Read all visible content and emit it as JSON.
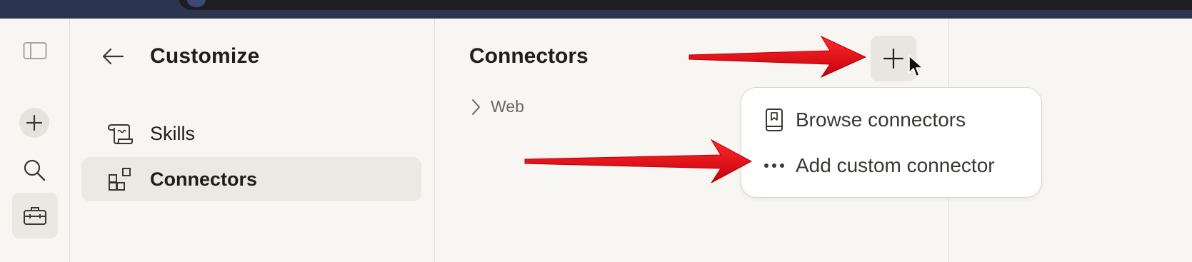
{
  "rail": {
    "icons": [
      "sidebar-toggle-icon",
      "plus-icon",
      "search-icon",
      "toolbox-icon"
    ]
  },
  "left_panel": {
    "title": "Customize",
    "items": [
      {
        "label": "Skills",
        "icon": "scroll-icon",
        "selected": false
      },
      {
        "label": "Connectors",
        "icon": "connectors-grid-icon",
        "selected": true
      }
    ]
  },
  "main": {
    "title": "Connectors",
    "tree": [
      {
        "label": "Web",
        "expanded": false
      }
    ]
  },
  "dropdown": {
    "items": [
      {
        "label": "Browse connectors",
        "icon": "book-icon"
      },
      {
        "label": "Add custom connector",
        "icon": "ellipsis-icon"
      }
    ]
  },
  "colors": {
    "background": "#f7f6f3",
    "selected_item": "#ebe9e2",
    "annotation_arrow": "#e3000f",
    "topbar": "#2b3550"
  }
}
